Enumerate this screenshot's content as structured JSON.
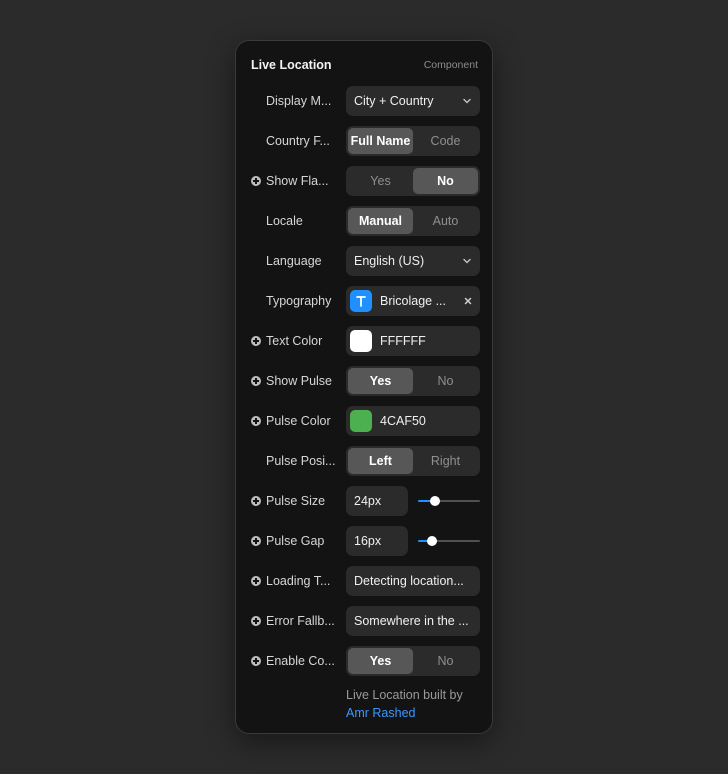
{
  "header": {
    "title": "Live Location",
    "kind": "Component"
  },
  "rows": {
    "display_mode": {
      "label": "Display M...",
      "value": "City + Country"
    },
    "country_format": {
      "label": "Country F...",
      "options": [
        "Full Name",
        "Code"
      ],
      "selected": "Full Name"
    },
    "show_flag": {
      "label": "Show Fla...",
      "options": [
        "Yes",
        "No"
      ],
      "selected": "No"
    },
    "locale": {
      "label": "Locale",
      "options": [
        "Manual",
        "Auto"
      ],
      "selected": "Manual"
    },
    "language": {
      "label": "Language",
      "value": "English (US)"
    },
    "typography": {
      "label": "Typography",
      "value": "Bricolage ...",
      "badge_color": "#1e90ff"
    },
    "text_color": {
      "label": "Text Color",
      "value": "FFFFFF",
      "color": "#ffffff"
    },
    "show_pulse": {
      "label": "Show Pulse",
      "options": [
        "Yes",
        "No"
      ],
      "selected": "Yes"
    },
    "pulse_color": {
      "label": "Pulse Color",
      "value": "4CAF50",
      "color": "#4caf50"
    },
    "pulse_position": {
      "label": "Pulse Posi...",
      "options": [
        "Left",
        "Right"
      ],
      "selected": "Left"
    },
    "pulse_size": {
      "label": "Pulse Size",
      "value": "24px",
      "slider_level": 0.27
    },
    "pulse_gap": {
      "label": "Pulse Gap",
      "value": "16px",
      "slider_level": 0.22
    },
    "loading_text": {
      "label": "Loading T...",
      "value": "Detecting location..."
    },
    "error_fallback": {
      "label": "Error Fallb...",
      "value": "Somewhere in the ..."
    },
    "enable_cache": {
      "label": "Enable Co...",
      "options": [
        "Yes",
        "No"
      ],
      "selected": "Yes"
    }
  },
  "footer": {
    "text": "Live Location built by",
    "author": "Amr Rashed"
  },
  "colors": {
    "accent": "#1e90ff",
    "link": "#3b97ff",
    "panel": "#131313",
    "control": "#2b2b2b"
  }
}
